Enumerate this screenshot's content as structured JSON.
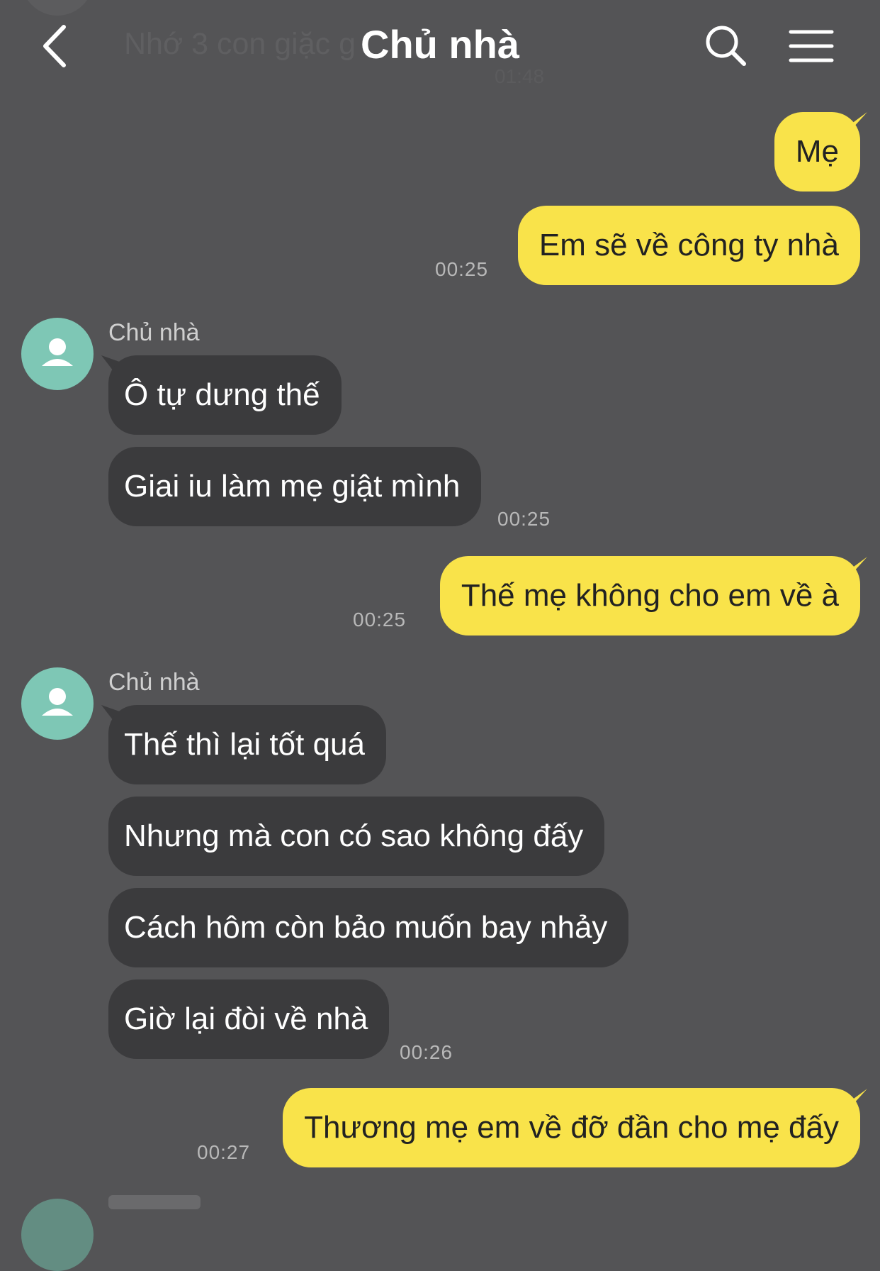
{
  "header": {
    "title": "Chủ nhà",
    "ghost_text": "Nhớ 3 con giặc g",
    "ghost_time": "01:48"
  },
  "icons": {
    "back": "chevron-left-icon",
    "search": "search-icon",
    "menu": "hamburger-menu-icon"
  },
  "colors": {
    "background": "#545456",
    "outgoing_bubble": "#f9e34a",
    "incoming_bubble": "#3b3b3d",
    "avatar": "#7ec7b5"
  },
  "messages": [
    {
      "dir": "out",
      "text": "Mẹ"
    },
    {
      "dir": "out",
      "text": "Em sẽ về công ty nhà",
      "time": "00:25"
    },
    {
      "sender": "Chủ nhà"
    },
    {
      "dir": "in",
      "text": "Ô tự dưng thế"
    },
    {
      "dir": "in",
      "text": "Giai iu làm mẹ giật mình",
      "time": "00:25"
    },
    {
      "dir": "out",
      "text": "Thế mẹ không cho em về à",
      "time": "00:25"
    },
    {
      "sender": "Chủ nhà"
    },
    {
      "dir": "in",
      "text": "Thế thì lại tốt quá"
    },
    {
      "dir": "in",
      "text": "Nhưng mà con có sao không đấy"
    },
    {
      "dir": "in",
      "text": "Cách hôm còn bảo muốn bay nhảy"
    },
    {
      "dir": "in",
      "text": "Giờ lại đòi về nhà",
      "time": "00:26"
    },
    {
      "dir": "out",
      "text": "Thương mẹ em về đỡ đần cho mẹ đấy",
      "time": "00:27"
    }
  ]
}
